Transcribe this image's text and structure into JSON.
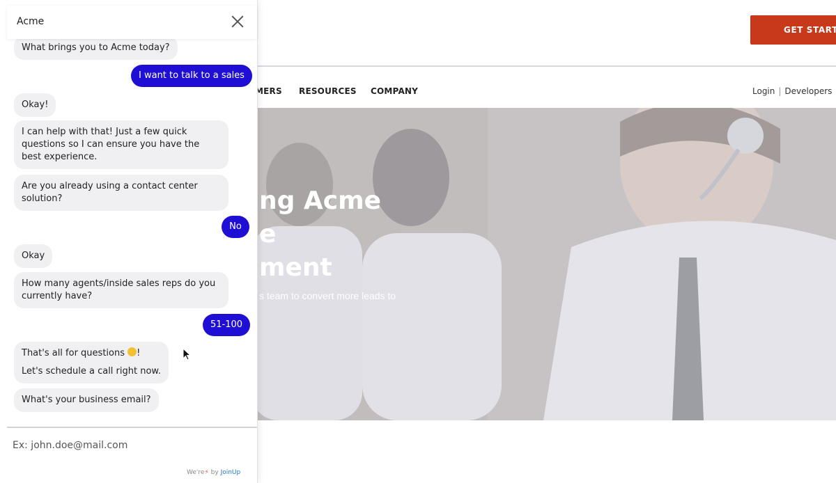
{
  "site": {
    "cta_label": "GET STARTED",
    "nav": [
      "MERS",
      "RESOURCES",
      "COMPANY"
    ],
    "nav_right": {
      "login": "Login",
      "separator": "|",
      "developers": "Developers"
    },
    "hero": {
      "title_lines": [
        "ng Acme",
        "e",
        "ment"
      ],
      "subtitle": "s team to convert more leads to"
    }
  },
  "chat": {
    "title": "Acme",
    "messages": [
      {
        "from": "bot",
        "text": "What brings you to Acme today?"
      },
      {
        "from": "user",
        "text": "I want to talk to a sales"
      },
      {
        "from": "bot",
        "text": "Okay!"
      },
      {
        "from": "bot",
        "text": "I can help with that! Just a few quick questions so I can ensure you have the best experience."
      },
      {
        "from": "bot",
        "text": "Are you already using a contact center solution?"
      },
      {
        "from": "user",
        "text": "No"
      },
      {
        "from": "bot",
        "text": "Okay"
      },
      {
        "from": "bot",
        "text": "How many agents/inside sales reps do you currently have?"
      },
      {
        "from": "user",
        "text": "51-100"
      },
      {
        "from": "bot",
        "text_line1": "That's all for questions",
        "text_line1_end": "!",
        "text_line2": "Let's schedule a call right now."
      },
      {
        "from": "bot",
        "text": "What's your business email?"
      }
    ],
    "input_placeholder": "Ex: john.doe@mail.com",
    "powered_by": {
      "prefix": "We're",
      "middle": "by",
      "brand": "JoinUp"
    }
  },
  "colors": {
    "user_bubble": "#1f0fd4",
    "bot_bubble": "#f0f0f3",
    "cta": "#c8381a"
  }
}
